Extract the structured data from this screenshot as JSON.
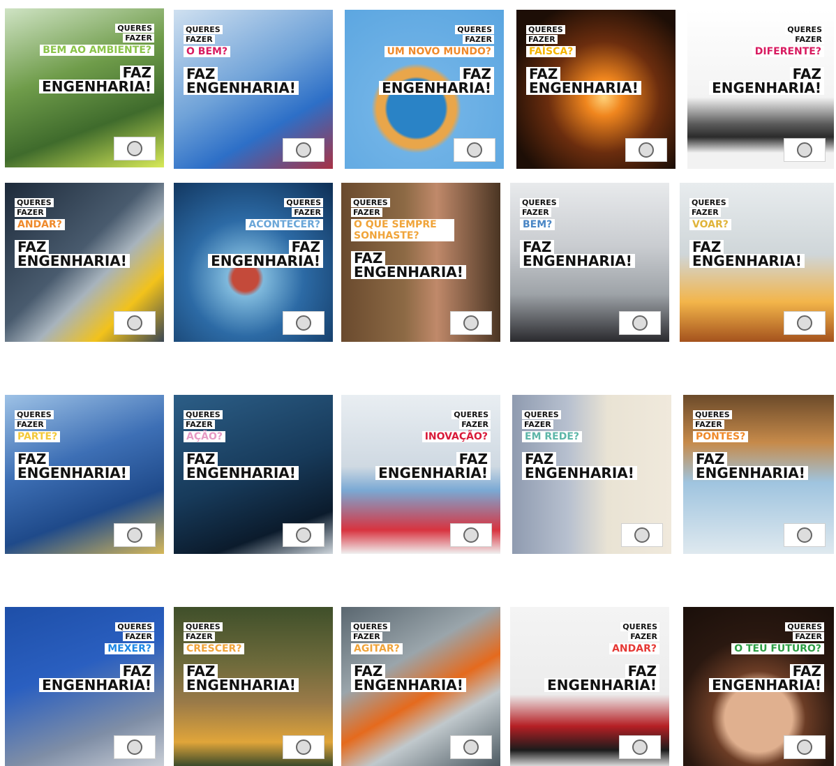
{
  "logo_alt": "Universidade logo",
  "tiles": [
    {
      "q1": "QUERES",
      "q2": "FAZER",
      "q3": "BEM AO AMBIENTE?",
      "qcolor": "#8bc34a",
      "a1": "FAZ",
      "a2": "ENGENHARIA!",
      "align": "right"
    },
    {
      "q1": "QUERES",
      "q2": "FAZER",
      "q3": "O BEM?",
      "qcolor": "#d81b60",
      "a1": "FAZ",
      "a2": "ENGENHARIA!",
      "align": "left"
    },
    {
      "q1": "QUERES",
      "q2": "FAZER",
      "q3": "UM NOVO MUNDO?",
      "qcolor": "#ef8a2b",
      "a1": "FAZ",
      "a2": "ENGENHARIA!",
      "align": "right"
    },
    {
      "q1": "QUERES",
      "q2": "FAZER",
      "q3": "FAÍSCA?",
      "qcolor": "#f4b400",
      "a1": "FAZ",
      "a2": "ENGENHARIA!",
      "align": "left"
    },
    {
      "q1": "QUERES",
      "q2": "FAZER",
      "q3": "DIFERENTE?",
      "qcolor": "#d81b60",
      "a1": "FAZ",
      "a2": "ENGENHARIA!",
      "align": "right"
    },
    {
      "q1": "QUERES",
      "q2": "FAZER",
      "q3": "ANDAR?",
      "qcolor": "#ef8a2b",
      "a1": "FAZ",
      "a2": "ENGENHARIA!",
      "align": "left"
    },
    {
      "q1": "QUERES",
      "q2": "FAZER",
      "q3": "ACONTECER?",
      "qcolor": "#6aa6d8",
      "a1": "FAZ",
      "a2": "ENGENHARIA!",
      "align": "right"
    },
    {
      "q1": "QUERES",
      "q2": "FAZER",
      "q3": "O QUE SEMPRE SONHASTE?",
      "qcolor": "#f0a43a",
      "a1": "FAZ",
      "a2": "ENGENHARIA!",
      "align": "left"
    },
    {
      "q1": "QUERES",
      "q2": "FAZER",
      "q3": "BEM?",
      "qcolor": "#4a86c5",
      "a1": "FAZ",
      "a2": "ENGENHARIA!",
      "align": "left"
    },
    {
      "q1": "QUERES",
      "q2": "FAZER",
      "q3": "VOAR?",
      "qcolor": "#e0b43a",
      "a1": "FAZ",
      "a2": "ENGENHARIA!",
      "align": "left"
    },
    {
      "q1": "QUERES",
      "q2": "FAZER",
      "q3": "PARTE?",
      "qcolor": "#f3c93b",
      "a1": "FAZ",
      "a2": "ENGENHARIA!",
      "align": "left"
    },
    {
      "q1": "QUERES",
      "q2": "FAZER",
      "q3": "AÇÃO?",
      "qcolor": "#e79ac4",
      "a1": "FAZ",
      "a2": "ENGENHARIA!",
      "align": "left"
    },
    {
      "q1": "QUERES",
      "q2": "FAZER",
      "q3": "INOVAÇÃO?",
      "qcolor": "#d81b3a",
      "a1": "FAZ",
      "a2": "ENGENHARIA!",
      "align": "right"
    },
    {
      "q1": "QUERES",
      "q2": "FAZER",
      "q3": "EM REDE?",
      "qcolor": "#5db6a8",
      "a1": "FAZ",
      "a2": "ENGENHARIA!",
      "align": "left"
    },
    {
      "q1": "QUERES",
      "q2": "FAZER",
      "q3": "PONTES?",
      "qcolor": "#ef8a2b",
      "a1": "FAZ",
      "a2": "ENGENHARIA!",
      "align": "left"
    },
    {
      "q1": "QUERES",
      "q2": "FAZER",
      "q3": "MEXER?",
      "qcolor": "#1e88e5",
      "a1": "FAZ",
      "a2": "ENGENHARIA!",
      "align": "right"
    },
    {
      "q1": "QUERES",
      "q2": "FAZER",
      "q3": "CRESCER?",
      "qcolor": "#f0a43a",
      "a1": "FAZ",
      "a2": "ENGENHARIA!",
      "align": "left"
    },
    {
      "q1": "QUERES",
      "q2": "FAZER",
      "q3": "AGITAR?",
      "qcolor": "#f0a43a",
      "a1": "FAZ",
      "a2": "ENGENHARIA!",
      "align": "left"
    },
    {
      "q1": "QUERES",
      "q2": "FAZER",
      "q3": "ANDAR?",
      "qcolor": "#e53935",
      "a1": "FAZ",
      "a2": "ENGENHARIA!",
      "align": "right"
    },
    {
      "q1": "QUERES",
      "q2": "FAZER",
      "q3": "O TEU FUTURO?",
      "qcolor": "#2e9e44",
      "a1": "FAZ",
      "a2": "ENGENHARIA!",
      "align": "right"
    }
  ]
}
